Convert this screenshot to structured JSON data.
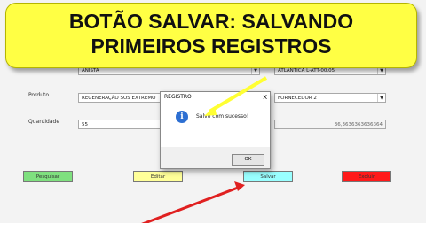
{
  "banner": {
    "line1": "BOTÃO SALVAR: SALVANDO",
    "line2": "PRIMEIROS REGISTROS"
  },
  "form": {
    "top_left_value": "ANISTA",
    "top_right_value": "ATLANTICA L-ATT-00.05",
    "produto_label": "Porduto",
    "produto_value": "REGENERAÇÃO SOS EXTREMO",
    "fornecedor_value": "FORNECEDOR 2",
    "quantidade_label": "Quantidade",
    "quantidade_value": "55",
    "computed_value": "36,3636363636364"
  },
  "buttons": {
    "pesquisar": "Pesquisar",
    "editar": "Editar",
    "salvar": "Salvar",
    "excluir": "Excluir"
  },
  "dialog": {
    "title": "REGISTRO",
    "close": "X",
    "info_glyph": "i",
    "message": "Salvo com sucesso!",
    "ok": "OK"
  },
  "icons": {
    "dropdown": "▼"
  },
  "colors": {
    "banner": "#ffff44",
    "pesquisar": "#7fe07f",
    "editar": "#ffff99",
    "salvar": "#99ffff",
    "excluir": "#ff1a1a",
    "arrow": "#e02020"
  }
}
